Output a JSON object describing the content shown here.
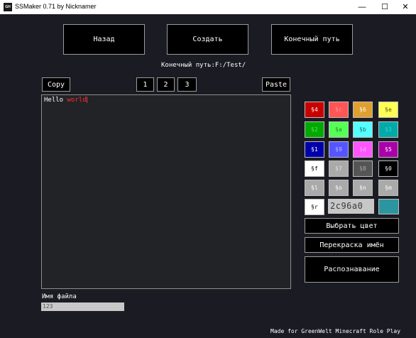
{
  "window": {
    "title": "SSMaker 0.71 by Nicknamer",
    "icon_text": "GH",
    "controls": {
      "minimize": "—",
      "maximize": "☐",
      "close": "✕"
    }
  },
  "top_buttons": {
    "back": "Назад",
    "create": "Создать",
    "final_path": "Конечный путь"
  },
  "path_label": "Конечный путь:F:/Test/",
  "toolbar": {
    "copy": "Copy",
    "paste": "Paste",
    "tab1": "1",
    "tab2": "2",
    "tab3": "3"
  },
  "editor": {
    "text_white": "Hello ",
    "text_red": "world"
  },
  "swatches": [
    {
      "code": "§4",
      "bg": "#c80000",
      "fg": "#ffffff"
    },
    {
      "code": "§c",
      "bg": "#ff5555",
      "fg": "#ff9a9a"
    },
    {
      "code": "§6",
      "bg": "#e0a030",
      "fg": "#ffffff"
    },
    {
      "code": "§e",
      "bg": "#ffff55",
      "fg": "#555500"
    },
    {
      "code": "§2",
      "bg": "#00aa00",
      "fg": "#6adb6a"
    },
    {
      "code": "§a",
      "bg": "#55ff55",
      "fg": "#228822"
    },
    {
      "code": "§b",
      "bg": "#55ffff",
      "fg": "#1a6a6a"
    },
    {
      "code": "§3",
      "bg": "#00aaaa",
      "fg": "#4ad0d0"
    },
    {
      "code": "§1",
      "bg": "#0000aa",
      "fg": "#ffffff"
    },
    {
      "code": "§9",
      "bg": "#5555ff",
      "fg": "#bcbcff"
    },
    {
      "code": "§d",
      "bg": "#ff55ff",
      "fg": "#ffaaff"
    },
    {
      "code": "§5",
      "bg": "#aa00aa",
      "fg": "#ffffff"
    },
    {
      "code": "§f",
      "bg": "#ffffff",
      "fg": "#000000"
    },
    {
      "code": "§7",
      "bg": "#aaaaaa",
      "fg": "#e0e0e0"
    },
    {
      "code": "§8",
      "bg": "#555555",
      "fg": "#aaaaaa"
    },
    {
      "code": "§0",
      "bg": "#000000",
      "fg": "#ffffff"
    },
    {
      "code": "§l",
      "bg": "#aaaaaa",
      "fg": "#ffffff"
    },
    {
      "code": "§o",
      "bg": "#aaaaaa",
      "fg": "#ffffff"
    },
    {
      "code": "§n",
      "bg": "#aaaaaa",
      "fg": "#ffffff"
    },
    {
      "code": "§m",
      "bg": "#aaaaaa",
      "fg": "#ffffff"
    },
    {
      "code": "§r",
      "bg": "#ffffff",
      "fg": "#000000"
    }
  ],
  "color_picker": {
    "hex_value": "2c96a0",
    "preview_color": "#2c96a0"
  },
  "side_buttons": {
    "choose_color": "Выбрать цвет",
    "recolor_names": "Перекраска имён",
    "recognize": "Распознавание"
  },
  "file": {
    "label": "Имя файла",
    "value": "123"
  },
  "footer": "Made for GreenWelt Minecraft Role Play"
}
